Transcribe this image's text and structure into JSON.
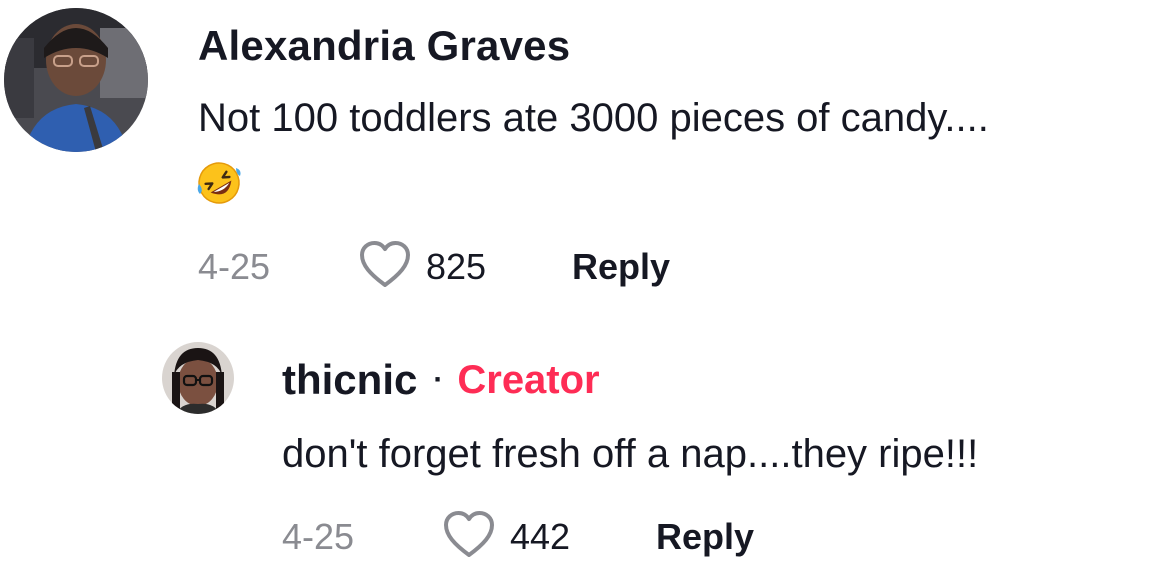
{
  "comments": [
    {
      "username": "Alexandria Graves",
      "text": "Not 100 toddlers ate 3000 pieces of candy....",
      "emoji_icon": "rolling-on-floor-laughing-emoji",
      "date": "4-25",
      "likes": "825",
      "reply_label": "Reply"
    },
    {
      "username": "thicnic",
      "separator": "·",
      "badge": "Creator",
      "text": "don't forget fresh off a nap....they ripe!!!",
      "date": "4-25",
      "likes": "442",
      "reply_label": "Reply"
    }
  ],
  "colors": {
    "text_primary": "#161823",
    "text_secondary": "#8a8b91",
    "creator_badge": "#fe2c55",
    "heart_outline": "#8a8b91"
  },
  "icons": {
    "like": "heart-outline-icon"
  }
}
